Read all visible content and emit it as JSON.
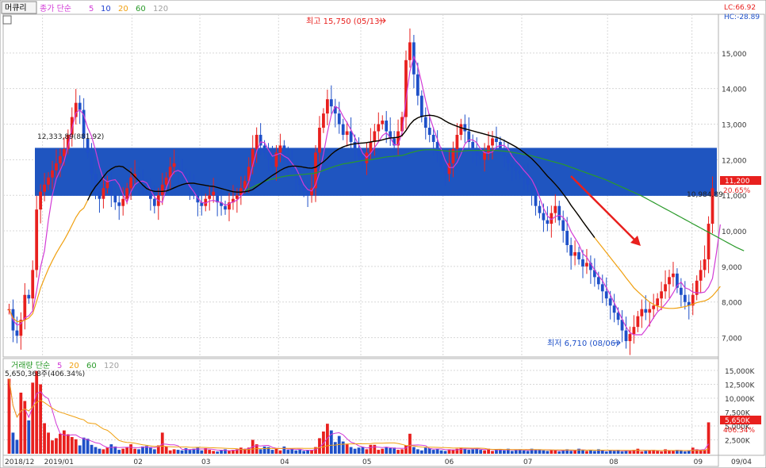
{
  "header": {
    "period_button": "머큐리",
    "price_legend": {
      "label": "종가 단순",
      "periods": [
        "5",
        "10",
        "20",
        "60",
        "120"
      ]
    },
    "volume_legend": {
      "label": "거래량 단순",
      "periods": [
        "5",
        "20",
        "60",
        "120"
      ]
    },
    "lc_label": "LC:66.92",
    "hc_label": "HC:-28.89"
  },
  "annotations": {
    "high_label": "최고 15,750 (05/13)",
    "low_label": "최저 6,710 (08/06)",
    "box_top_label": "12,333,89(881.92)",
    "box_bottom_label": "10,984.89",
    "last_price": "11,200",
    "last_change": "20.65%",
    "last_volume": "5,650K",
    "last_volume_change": "406.34%",
    "volume_info": "5,650,368주(406.34%)"
  },
  "colors": {
    "up": "#e8201e",
    "down": "#1e50c8",
    "box": "#1f55c0",
    "ma5": "#d23bd6",
    "ma10": "#2040d0",
    "ma20": "#f0a010",
    "ma60": "#2a9a2a",
    "ma120": "#a0a0a0",
    "black_line": "#000000"
  },
  "chart_data": [
    {
      "type": "candlestick",
      "title": "",
      "y_ticks": [
        "7,000",
        "8,000",
        "9,000",
        "10,000",
        "11,000",
        "12,000",
        "13,000",
        "14,000",
        "15,000"
      ],
      "ylim": [
        6500,
        16000
      ],
      "x_labels": [
        "2018/12",
        "2019/01",
        "02",
        "03",
        "04",
        "05",
        "06",
        "07",
        "08",
        "09",
        "09/04"
      ],
      "highlight_zone": [
        10984.89,
        12333.89
      ],
      "series": [
        {
          "name": "close",
          "values": [
            7800,
            7200,
            7050,
            7500,
            8200,
            8100,
            8900,
            10600,
            11100,
            11300,
            11500,
            11700,
            11900,
            12100,
            12300,
            12700,
            13200,
            13600,
            13400,
            12600,
            12200,
            11600,
            11100,
            10900,
            11200,
            11400,
            11000,
            10800,
            10700,
            10900,
            11200,
            11500,
            11600,
            11400,
            11300,
            11200,
            10900,
            10700,
            11000,
            11300,
            11500,
            11800,
            11900,
            11700,
            11600,
            11400,
            11200,
            11100,
            10800,
            10700,
            10900,
            11000,
            11100,
            10800,
            10700,
            10600,
            10800,
            10900,
            11000,
            11200,
            11400,
            11800,
            12300,
            12700,
            12400,
            12200,
            12000,
            11800,
            12200,
            12400,
            12100,
            11900,
            11700,
            11500,
            11300,
            11100,
            11000,
            11200,
            12200,
            12900,
            13300,
            13700,
            13500,
            13300,
            13000,
            12700,
            12800,
            12500,
            12300,
            12100,
            11900,
            12200,
            12500,
            12800,
            13000,
            13100,
            12800,
            12600,
            12400,
            12800,
            13200,
            14800,
            15300,
            14400,
            13800,
            13200,
            12900,
            12700,
            12500,
            12200,
            11800,
            11600,
            11900,
            12300,
            12700,
            13000,
            12800,
            12500,
            12300,
            12100,
            12000,
            12200,
            12400,
            12600,
            12500,
            12300,
            12100,
            11900,
            11800,
            11700,
            11600,
            11500,
            11300,
            11100,
            10700,
            10500,
            10300,
            10200,
            10500,
            10700,
            10300,
            10000,
            9600,
            9300,
            9400,
            9200,
            9000,
            9100,
            8900,
            8700,
            8500,
            8300,
            8100,
            7900,
            7700,
            7500,
            7200,
            6900,
            7100,
            7300,
            7600,
            7800,
            7700,
            7800,
            7900,
            8100,
            8300,
            8500,
            8700,
            8800,
            8400,
            8200,
            8000,
            7900,
            8200,
            8600,
            8900,
            9200,
            10200,
            11200
          ]
        },
        {
          "name": "MA5",
          "values": [
            7800,
            7500,
            7350,
            7390,
            7550,
            7610,
            7750,
            8320,
            8980,
            9440,
            10300,
            11000,
            11460,
            11700,
            11960,
            12380,
            12880,
            13320,
            13400,
            13260,
            12900,
            12660,
            12260,
            11800,
            11460,
            11380,
            11420,
            11440,
            11300,
            11020,
            10800,
            11100,
            11300,
            11380,
            11400,
            11350,
            11150,
            10950,
            10850,
            10800,
            11200,
            11500,
            11660,
            11700,
            11640,
            11450,
            11250,
            11100,
            10920,
            10800,
            10780,
            10840,
            10860,
            10820,
            10800,
            10720,
            10760,
            10820,
            10860,
            10980,
            11140,
            11380,
            11840,
            12240,
            12500,
            12480,
            12280,
            12100,
            12140,
            12180,
            12100,
            12040,
            11900,
            11760,
            11540,
            11300,
            11160,
            11120,
            11300,
            11640,
            12160,
            12760,
            13260,
            13500,
            13440,
            13220,
            13040,
            12840,
            12620,
            12420,
            12180,
            12060,
            12180,
            12340,
            12500,
            12680,
            12760,
            12620,
            12420,
            12420,
            12760,
            13700,
            14480,
            14900,
            14620,
            14160,
            13660,
            13220,
            12880,
            12580,
            12280,
            11980,
            11780,
            11780,
            11920,
            12160,
            12440,
            12560,
            12560,
            12480,
            12300,
            12200,
            12180,
            12220,
            12360,
            12400,
            12400,
            12300,
            12100,
            11960,
            11840,
            11700,
            11580,
            11440,
            11220,
            10940,
            10640,
            10420,
            10320,
            10400,
            10440,
            10380,
            10240,
            9980,
            9800,
            9620,
            9360,
            9260,
            9080,
            8900,
            8740,
            8600,
            8400,
            8200,
            7980,
            7760,
            7520,
            7300,
            7140,
            7080,
            7080,
            7080,
            7220,
            7380,
            7560,
            7720,
            7820,
            7940,
            8080,
            8260,
            8460,
            8560,
            8400,
            8360,
            8280,
            8260,
            8260,
            8280,
            8420,
            8660,
            9380,
            10180
          ]
        },
        {
          "name": "MA20",
          "values": [
            7800,
            7550,
            7450,
            7450,
            7490,
            7550,
            7670,
            8020,
            8390,
            8670,
            8930,
            9160,
            9370,
            9560,
            9740,
            9940,
            10160,
            10380,
            10550,
            10640,
            10860,
            11080,
            11250,
            11380,
            11520,
            11660,
            11740,
            11800,
            11820,
            11800,
            11720,
            11640,
            11520,
            11410,
            11290,
            11190,
            11140,
            11110,
            11110,
            11110,
            11120,
            11160,
            11210,
            11260,
            11300,
            11330,
            11340,
            11340,
            11320,
            11300,
            11280,
            11260,
            11250,
            11220,
            11190,
            11160,
            11130,
            11100,
            11090,
            11090,
            11100,
            11120,
            11160,
            11240,
            11320,
            11400,
            11480,
            11560,
            11630,
            11700,
            11760,
            11800,
            11820,
            11820,
            11810,
            11790,
            11770,
            11760,
            11790,
            11860,
            11940,
            12040,
            12150,
            12240,
            12310,
            12360,
            12400,
            12430,
            12450,
            12460,
            12470,
            12480,
            12500,
            12520,
            12530,
            12560,
            12590,
            12610,
            12620,
            12630,
            12680,
            12820,
            12990,
            13110,
            13180,
            13220,
            13240,
            13250,
            13240,
            13210,
            13160,
            13090,
            13030,
            12980,
            12940,
            12900,
            12870,
            12840,
            12810,
            12780,
            12750,
            12720,
            12690,
            12660,
            12630,
            12590,
            12540,
            12480,
            12420,
            12360,
            12290,
            12210,
            12120,
            12030,
            11920,
            11800,
            11670,
            11540,
            11430,
            11310,
            11180,
            11040,
            10890,
            10720,
            10570,
            10420,
            10260,
            10110,
            9960,
            9810,
            9670,
            9530,
            9390,
            9250,
            9110,
            8970,
            8830,
            8680,
            8540,
            8400,
            8290,
            8190,
            8090,
            8000,
            7930,
            7880,
            7850,
            7830,
            7820,
            7820,
            7830,
            7850,
            7870,
            7900,
            7940,
            7980,
            8010,
            8030,
            8080,
            8170,
            8300,
            8440
          ]
        },
        {
          "name": "MA60",
          "values": [
            null,
            null,
            null,
            null,
            null,
            null,
            null,
            null,
            null,
            null,
            null,
            null,
            null,
            null,
            null,
            null,
            null,
            null,
            null,
            null,
            null,
            null,
            null,
            null,
            null,
            null,
            null,
            null,
            null,
            null,
            null,
            null,
            null,
            null,
            null,
            null,
            null,
            null,
            null,
            null,
            null,
            null,
            null,
            null,
            null,
            null,
            null,
            null,
            null,
            null,
            null,
            null,
            null,
            null,
            null,
            null,
            null,
            null,
            null,
            null,
            11130,
            11180,
            11230,
            11290,
            11340,
            11390,
            11430,
            11460,
            11480,
            11510,
            11530,
            11550,
            11560,
            11570,
            11580,
            11590,
            11600,
            11610,
            11630,
            11660,
            11700,
            11740,
            11780,
            11820,
            11850,
            11880,
            11900,
            11920,
            11940,
            11960,
            11980,
            11990,
            12000,
            12020,
            12040,
            12060,
            12080,
            12090,
            12100,
            12110,
            12120,
            12150,
            12190,
            12220,
            12250,
            12270,
            12280,
            12280,
            12280,
            12270,
            12260,
            12250,
            12240,
            12230,
            12230,
            12240,
            12250,
            12260,
            12260,
            12260,
            12260,
            12260,
            12260,
            12260,
            12260,
            12250,
            12240,
            12230,
            12210,
            12190,
            12170,
            12150,
            12130,
            12110,
            12080,
            12050,
            12020,
            11990,
            11960,
            11930,
            11900,
            11870,
            11830,
            11790,
            11750,
            11710,
            11670,
            11630,
            11590,
            11550,
            11510,
            11470,
            11430,
            11380,
            11330,
            11280,
            11230,
            11180,
            11130,
            11080,
            11030,
            10980,
            10920,
            10860,
            10800,
            10740,
            10680,
            10620,
            10560,
            10500,
            10440,
            10380,
            10320,
            10260,
            10200,
            10140,
            10080,
            10020,
            9960,
            9900,
            9840,
            9780,
            9720,
            9660,
            9600,
            9540,
            9490,
            9440
          ]
        }
      ]
    },
    {
      "type": "bar",
      "title": "",
      "y_ticks": [
        "2,500K",
        "5,000K",
        "7,500K",
        "10,000K",
        "12,500K",
        "15,000K"
      ],
      "ylim": [
        0,
        16000
      ],
      "series": [
        {
          "name": "volume",
          "values": [
            13500,
            3800,
            2500,
            11000,
            9500,
            6000,
            12800,
            14900,
            12500,
            5500,
            3800,
            2400,
            2800,
            3600,
            4200,
            3500,
            3000,
            2600,
            1500,
            2900,
            2700,
            1600,
            1200,
            900,
            800,
            1100,
            1700,
            1300,
            700,
            900,
            1200,
            1700,
            900,
            800,
            1300,
            1400,
            1200,
            800,
            1500,
            3800,
            1300,
            600,
            800,
            700,
            600,
            1000,
            700,
            900,
            1100,
            600,
            1000,
            700,
            500,
            400,
            600,
            800,
            500,
            700,
            800,
            1100,
            900,
            1100,
            2500,
            1700,
            800,
            1300,
            1200,
            700,
            900,
            600,
            1300,
            700,
            800,
            600,
            700,
            500,
            600,
            700,
            1200,
            2800,
            4000,
            5400,
            4200,
            2100,
            3200,
            2200,
            1700,
            1200,
            900,
            1100,
            1200,
            800,
            1600,
            1600,
            700,
            900,
            1200,
            1000,
            1100,
            700,
            800,
            1500,
            3600,
            1200,
            800,
            600,
            1100,
            1000,
            700,
            900,
            600,
            500,
            800,
            700,
            900,
            1100,
            900,
            700,
            800,
            1000,
            700,
            600,
            900,
            500,
            800,
            700,
            600,
            900,
            500,
            700,
            800,
            600,
            500,
            900,
            700,
            800,
            600,
            500,
            700,
            600,
            400,
            700,
            800,
            500,
            600,
            900,
            700,
            500,
            600,
            500,
            800,
            700,
            400,
            600,
            500,
            700,
            400,
            600,
            500,
            700,
            900,
            400,
            500,
            600,
            700,
            500,
            400,
            800,
            500,
            600,
            700,
            500,
            400,
            600,
            1100,
            800,
            600,
            700,
            5650
          ]
        }
      ]
    }
  ]
}
